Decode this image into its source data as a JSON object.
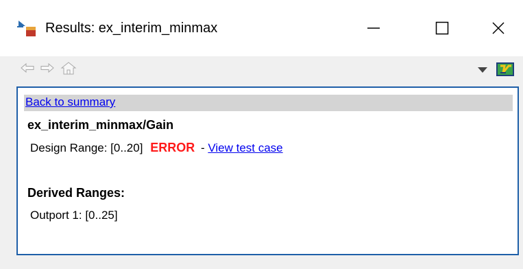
{
  "window": {
    "title": "Results: ex_interim_minmax",
    "icons": {
      "app": "simulink-results-icon",
      "minimize": "minimize-icon",
      "maximize": "maximize-icon",
      "close": "close-icon"
    }
  },
  "toolbar": {
    "icons": [
      "back-arrow-icon",
      "forward-arrow-icon",
      "home-icon",
      "chevron-down-icon",
      "help-icon"
    ]
  },
  "content": {
    "summary_link": "Back to summary",
    "block_path": "ex_interim_minmax/Gain",
    "design_range_label": "Design Range: [0..20]",
    "error_label": "ERROR",
    "separator": "-",
    "test_case_link": "View test case",
    "derived_title": "Derived Ranges:",
    "outport_label": "Outport 1: [0..25]"
  },
  "colors": {
    "error": "#ff1a1a",
    "link": "#0000ee",
    "content_border": "#1e5fa8",
    "summary_bar": "#d4d4d4"
  }
}
